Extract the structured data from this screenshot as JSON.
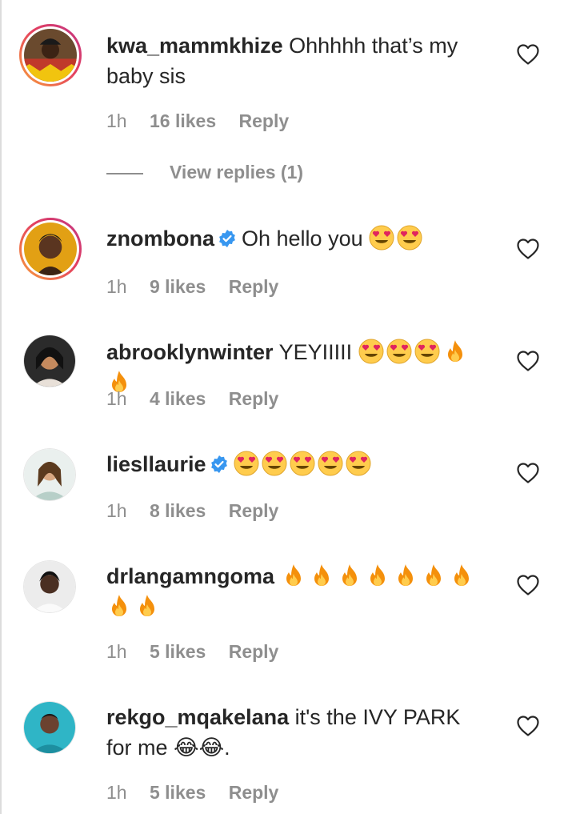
{
  "comments": [
    {
      "username": "kwa_mammkhize",
      "verified": false,
      "text": "Ohhhhh that’s my baby sis",
      "emojis": [],
      "time": "1h",
      "likes": "16 likes",
      "reply": "Reply"
    },
    {
      "username": "znombona",
      "verified": true,
      "text": "Oh hello you",
      "emojis": [
        "heart-eyes",
        "heart-eyes"
      ],
      "time": "1h",
      "likes": "9 likes",
      "reply": "Reply"
    },
    {
      "username": "abrooklynwinter",
      "verified": false,
      "text": "YEYIIIII",
      "emojis": [
        "heart-eyes",
        "heart-eyes",
        "heart-eyes",
        "fire",
        "fire"
      ],
      "time": "1h",
      "likes": "4 likes",
      "reply": "Reply"
    },
    {
      "username": "liesllaurie",
      "verified": true,
      "text": "",
      "emojis": [
        "heart-eyes",
        "heart-eyes",
        "heart-eyes",
        "heart-eyes",
        "heart-eyes"
      ],
      "time": "1h",
      "likes": "8 likes",
      "reply": "Reply"
    },
    {
      "username": "drlangamngoma",
      "verified": false,
      "text": "",
      "emojis": [
        "fire",
        "fire",
        "fire",
        "fire",
        "fire",
        "fire",
        "fire",
        "fire",
        "fire"
      ],
      "time": "1h",
      "likes": "5 likes",
      "reply": "Reply"
    },
    {
      "username": "rekgo_mqakelana",
      "verified": false,
      "text": "it's the IVY PARK for me 😂😂.",
      "emojis": [],
      "time": "1h",
      "likes": "5 likes",
      "reply": "Reply"
    }
  ],
  "view_replies": "View replies (1)",
  "icons": {
    "like": "heart-outline-icon",
    "verified": "verified-badge-icon"
  },
  "colors": {
    "verified": "#3897f0",
    "muted": "#8e8e8e",
    "text": "#262626"
  }
}
